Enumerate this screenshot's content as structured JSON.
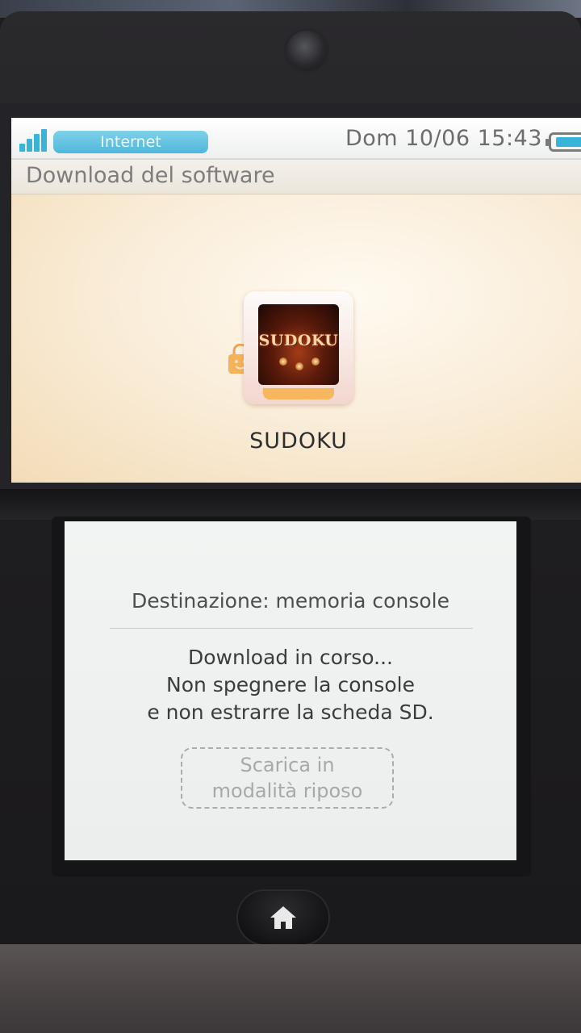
{
  "status_bar": {
    "connection_label": "Internet",
    "datetime": "Dom 10/06  15:43",
    "signal_icon": "signal-bars-icon",
    "battery_icon": "battery-icon"
  },
  "top_screen": {
    "title": "Download del software",
    "game_icon_text": "SUDOKU",
    "game_title": "SUDOKU",
    "shop_icon": "shopping-bag-icon"
  },
  "bottom_screen": {
    "destination": "Destinazione: memoria console",
    "message_lines": [
      "Download in corso...",
      "Non spegnere la console",
      "e non estrarre la scheda SD."
    ],
    "sleep_download_button": {
      "line1": "Scarica in",
      "line2": "modalità riposo"
    }
  },
  "hardware": {
    "home_icon": "home-icon"
  },
  "colors": {
    "accent": "#39b4d8",
    "top_background": "#f7ecd8",
    "bottom_background": "#eef0ef",
    "tile_base": "#f6b75d"
  }
}
